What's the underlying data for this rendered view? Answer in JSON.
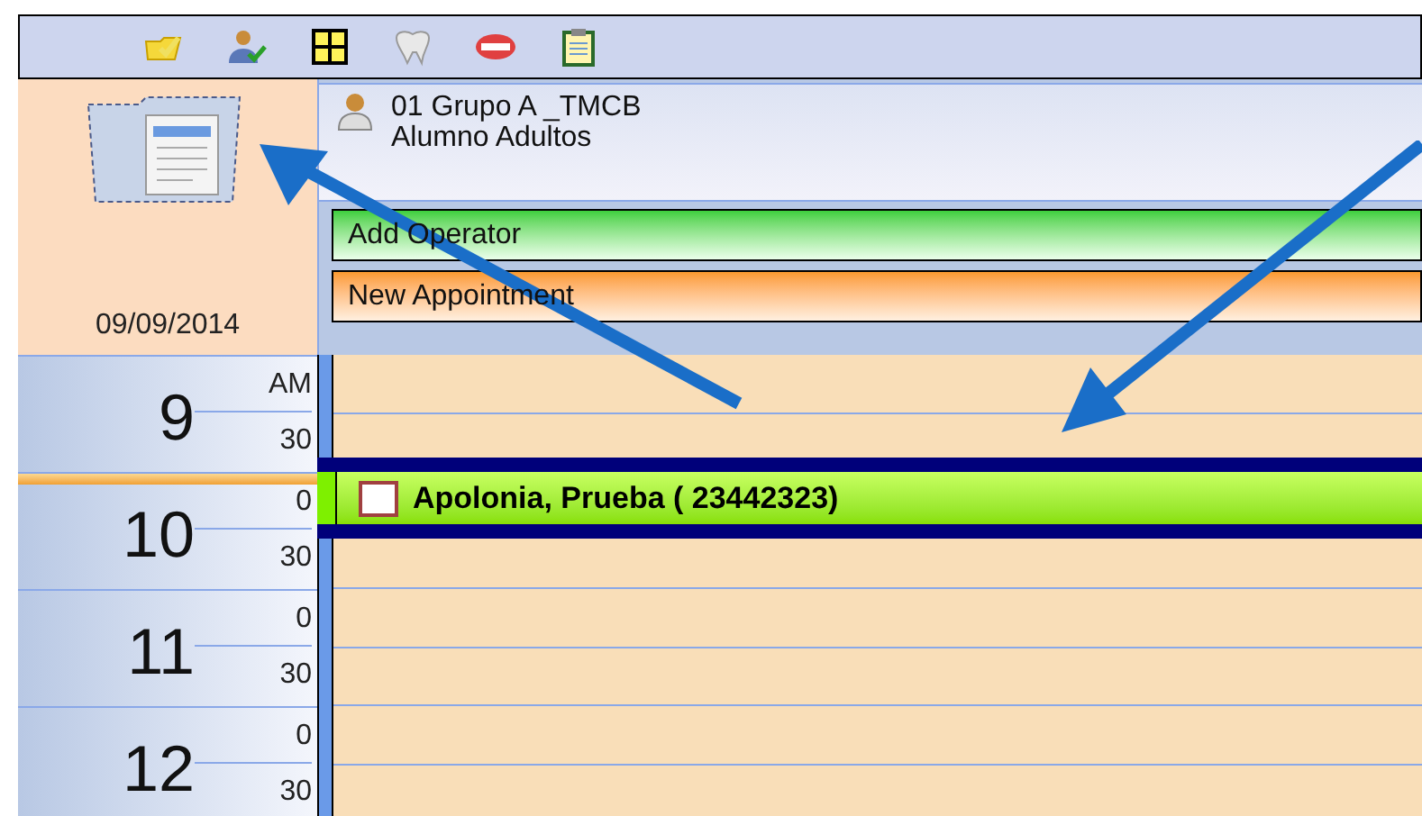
{
  "date": "09/09/2014",
  "operator": {
    "name": "01 Grupo A _TMCB",
    "subtitle": "Alumno Adultos"
  },
  "actions": [
    {
      "label": "Add Operator",
      "kind": "green"
    },
    {
      "label": "New Appointment",
      "kind": "orange"
    }
  ],
  "hours": [
    {
      "hour": "9",
      "top_label": "AM",
      "half_label": "30",
      "selected": false
    },
    {
      "hour": "10",
      "top_label": "0",
      "half_label": "30",
      "selected": true
    },
    {
      "hour": "11",
      "top_label": "0",
      "half_label": "30",
      "selected": false
    },
    {
      "hour": "12",
      "top_label": "0",
      "half_label": "30",
      "selected": false
    }
  ],
  "appointment": {
    "patient": "Apolonia, Prueba ( 23442323)",
    "checked": false
  }
}
